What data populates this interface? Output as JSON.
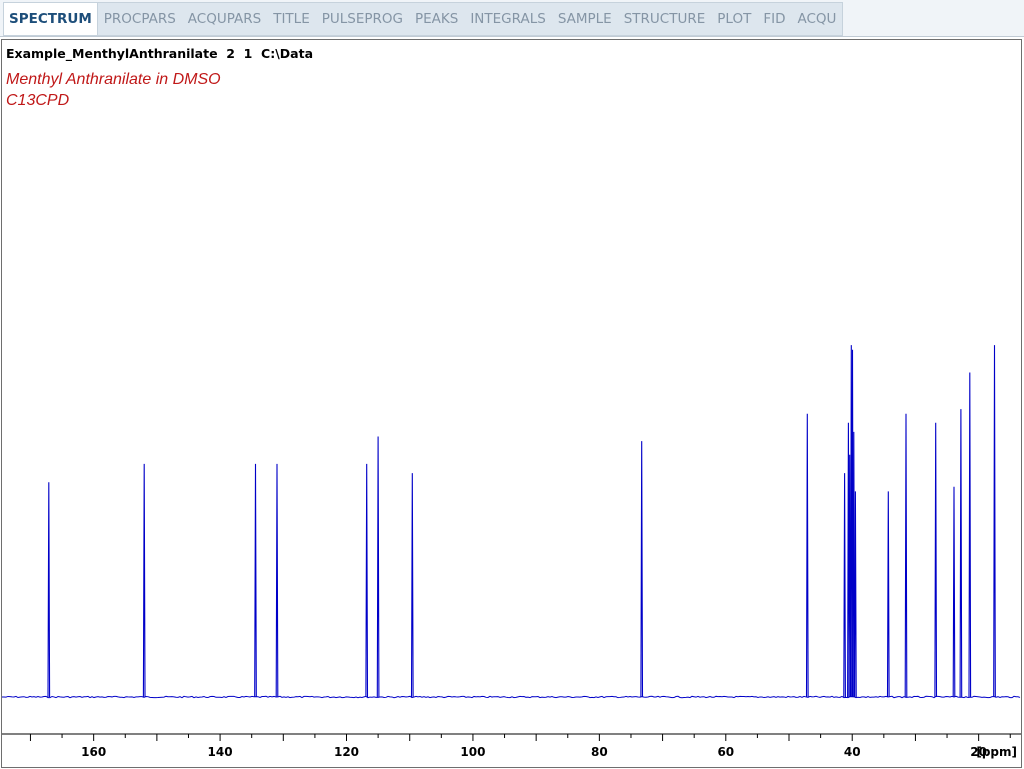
{
  "tabs": [
    {
      "label": "SPECTRUM",
      "active": true
    },
    {
      "label": "PROCPARS",
      "active": false
    },
    {
      "label": "ACQUPARS",
      "active": false
    },
    {
      "label": "TITLE",
      "active": false
    },
    {
      "label": "PULSEPROG",
      "active": false
    },
    {
      "label": "PEAKS",
      "active": false
    },
    {
      "label": "INTEGRALS",
      "active": false
    },
    {
      "label": "SAMPLE",
      "active": false
    },
    {
      "label": "STRUCTURE",
      "active": false
    },
    {
      "label": "PLOT",
      "active": false
    },
    {
      "label": "FID",
      "active": false
    },
    {
      "label": "ACQU",
      "active": false
    }
  ],
  "dataset_line": "Example_MenthylAnthranilate  2  1  C:\\Data",
  "title_lines": [
    "Menthyl Anthranilate in DMSO",
    "C13CPD"
  ],
  "colors": {
    "spectrum": "#0000c8",
    "title_text": "#c01818",
    "active_tab_text": "#1d4e7a"
  },
  "chart_data": {
    "type": "line",
    "x_axis": {
      "reversed": true,
      "range": [
        174.5,
        13.3
      ],
      "tick_labels": [
        "160",
        "140",
        "120",
        "100",
        "80",
        "60",
        "40",
        "20"
      ],
      "unit_label": "[ppm]"
    },
    "peaks": [
      {
        "ppm": 167.1,
        "intensity": 0.47
      },
      {
        "ppm": 152.0,
        "intensity": 0.51
      },
      {
        "ppm": 134.4,
        "intensity": 0.51
      },
      {
        "ppm": 131.0,
        "intensity": 0.51
      },
      {
        "ppm": 116.8,
        "intensity": 0.51
      },
      {
        "ppm": 115.0,
        "intensity": 0.57
      },
      {
        "ppm": 109.6,
        "intensity": 0.49
      },
      {
        "ppm": 73.3,
        "intensity": 0.56
      },
      {
        "ppm": 47.1,
        "intensity": 0.62
      },
      {
        "ppm": 41.2,
        "intensity": 0.49
      },
      {
        "ppm": 40.6,
        "intensity": 0.6
      },
      {
        "ppm": 40.4,
        "intensity": 0.53
      },
      {
        "ppm": 40.15,
        "intensity": 0.77
      },
      {
        "ppm": 39.95,
        "intensity": 0.76
      },
      {
        "ppm": 39.75,
        "intensity": 0.58
      },
      {
        "ppm": 39.5,
        "intensity": 0.45
      },
      {
        "ppm": 34.3,
        "intensity": 0.45
      },
      {
        "ppm": 31.5,
        "intensity": 0.62
      },
      {
        "ppm": 26.8,
        "intensity": 0.6
      },
      {
        "ppm": 23.9,
        "intensity": 0.46
      },
      {
        "ppm": 22.8,
        "intensity": 0.63
      },
      {
        "ppm": 21.4,
        "intensity": 0.71
      },
      {
        "ppm": 17.5,
        "intensity": 0.77
      }
    ]
  }
}
